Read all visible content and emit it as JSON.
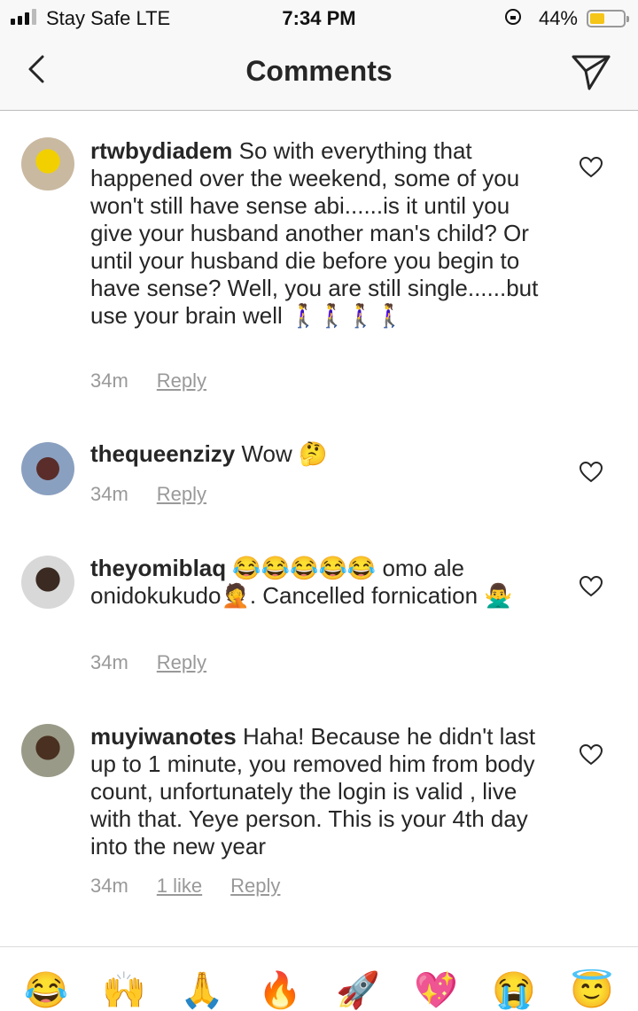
{
  "status_bar": {
    "carrier": "Stay Safe  LTE",
    "time": "7:34 PM",
    "battery_percent": "44%",
    "battery_level": 0.44,
    "signal_bars": 3
  },
  "header": {
    "title": "Comments",
    "back_icon": "chevron-left-icon",
    "share_icon": "paper-plane-icon"
  },
  "comments": [
    {
      "username": "rtwbydiadem",
      "text": " So with everything that happened over the weekend, some of you won't still have sense abi......is it until you give your husband another man's child? Or until your husband die before you begin to have sense? Well, you are still single......but use your brain well 🚶‍♀️🚶‍♀️🚶‍♀️🚶‍♀️",
      "time": "34m",
      "likes": "",
      "reply": "Reply"
    },
    {
      "username": "thequeenzizy",
      "text": " Wow 🤔",
      "time": "34m",
      "likes": "",
      "reply": "Reply"
    },
    {
      "username": "theyomiblaq",
      "text": " 😂😂😂😂😂 omo ale onidokukudo🤦. Cancelled fornication 🙅‍♂️",
      "time": "34m",
      "likes": "",
      "reply": "Reply"
    },
    {
      "username": "muyiwanotes",
      "text": " Haha! Because he didn't last up to 1 minute, you removed him from body count, unfortunately the login is valid , live with that. Yeye person. This is your 4th day into the new year",
      "time": "34m",
      "likes": "1 like",
      "reply": "Reply"
    }
  ],
  "emoji_bar": [
    "😂",
    "🙌",
    "🙏",
    "🔥",
    "🚀",
    "💖",
    "😭",
    "😇"
  ],
  "colors": {
    "text": "#262626",
    "meta": "#999999",
    "bar_bg": "#f8f8f8",
    "battery": "#f5c518"
  }
}
